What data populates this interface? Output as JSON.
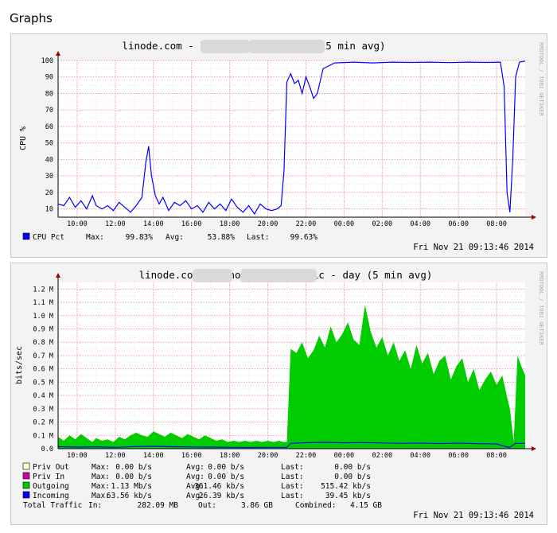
{
  "page_heading": "Graphs",
  "rrdtool_credit": "RRDTOOL / TOBI OETIKER",
  "chart_data": [
    {
      "type": "line",
      "title": "linode.com - lino( ) - CPU - day (5 min avg)",
      "ylabel": "CPU %",
      "ylim": [
        5,
        100
      ],
      "y_ticks": [
        "10",
        "20",
        "30",
        "40",
        "50",
        "60",
        "70",
        "80",
        "90",
        "100"
      ],
      "x_ticks": [
        "10:00",
        "12:00",
        "14:00",
        "16:00",
        "18:00",
        "20:00",
        "22:00",
        "00:00",
        "02:00",
        "04:00",
        "06:00",
        "08:00"
      ],
      "xlim_hours": [
        9.0,
        33.5
      ],
      "grid": true,
      "series": [
        {
          "name": "CPU Pct",
          "color": "#0000ff",
          "hours": [
            9.0,
            9.3,
            9.6,
            9.9,
            10.2,
            10.5,
            10.8,
            11.0,
            11.3,
            11.6,
            11.9,
            12.2,
            12.5,
            12.8,
            13.1,
            13.4,
            13.6,
            13.75,
            13.9,
            14.1,
            14.3,
            14.5,
            14.8,
            15.1,
            15.4,
            15.7,
            16.0,
            16.3,
            16.6,
            16.9,
            17.2,
            17.5,
            17.8,
            18.1,
            18.4,
            18.7,
            19.0,
            19.3,
            19.6,
            19.9,
            20.2,
            20.5,
            20.7,
            20.85,
            21.0,
            21.2,
            21.4,
            21.6,
            21.8,
            22.0,
            22.2,
            22.4,
            22.6,
            22.9,
            23.5,
            24.5,
            25.5,
            26.5,
            27.5,
            28.5,
            29.5,
            30.5,
            31.5,
            32.2,
            32.4,
            32.55,
            32.7,
            32.85,
            33.0,
            33.2,
            33.5
          ],
          "values": [
            13,
            12,
            17,
            11,
            15,
            10,
            18,
            12,
            10,
            12,
            9,
            14,
            11,
            8,
            12,
            17,
            38,
            48,
            30,
            18,
            13,
            17,
            9,
            14,
            12,
            15,
            10,
            12,
            8,
            14,
            10,
            13,
            9,
            16,
            11,
            8,
            12,
            7,
            13,
            10,
            9,
            10,
            12,
            33,
            87,
            92,
            86,
            88,
            80,
            90,
            84,
            77,
            80,
            95,
            98.5,
            99,
            98.5,
            99,
            98.8,
            99,
            98.7,
            99,
            98.8,
            99,
            84,
            20,
            8,
            40,
            90,
            99,
            99.6
          ]
        }
      ],
      "legend": [
        {
          "name": "CPU Pct",
          "color": "#0000ff",
          "max": "99.83%",
          "avg": "53.88%",
          "last": "99.63%"
        }
      ],
      "stat_labels": {
        "max": "Max:",
        "avg": "Avg:",
        "last": "Last:"
      },
      "timestamp": "Fri Nov 21 09:13:46 2014"
    },
    {
      "type": "area",
      "title": "linode.com - linod( ) - traffic - day (5 min avg)",
      "ylabel": "bits/sec",
      "ylim": [
        0,
        1.25
      ],
      "y_ticks": [
        "0.0",
        "0.1 M",
        "0.2 M",
        "0.3 M",
        "0.4 M",
        "0.5 M",
        "0.6 M",
        "0.7 M",
        "0.8 M",
        "0.9 M",
        "1.0 M",
        "1.1 M",
        "1.2 M"
      ],
      "x_ticks": [
        "10:00",
        "12:00",
        "14:00",
        "16:00",
        "18:00",
        "20:00",
        "22:00",
        "00:00",
        "02:00",
        "04:00",
        "06:00",
        "08:00"
      ],
      "xlim_hours": [
        9.0,
        33.5
      ],
      "grid": true,
      "series": [
        {
          "name": "Outgoing",
          "color": "#00cc00",
          "unit": "Mb/s",
          "hours": [
            9.0,
            9.3,
            9.6,
            9.9,
            10.2,
            10.5,
            10.8,
            11.0,
            11.3,
            11.6,
            11.9,
            12.2,
            12.5,
            12.8,
            13.1,
            13.4,
            13.7,
            14.0,
            14.3,
            14.6,
            14.9,
            15.2,
            15.5,
            15.8,
            16.1,
            16.4,
            16.7,
            17.0,
            17.3,
            17.6,
            17.9,
            18.2,
            18.5,
            18.8,
            19.1,
            19.4,
            19.7,
            20.0,
            20.3,
            20.6,
            20.8,
            21.0,
            21.2,
            21.5,
            21.8,
            22.1,
            22.4,
            22.7,
            23.0,
            23.3,
            23.6,
            23.9,
            24.2,
            24.5,
            24.8,
            25.1,
            25.4,
            25.7,
            26.0,
            26.3,
            26.6,
            26.9,
            27.2,
            27.5,
            27.8,
            28.1,
            28.4,
            28.7,
            29.0,
            29.3,
            29.6,
            29.9,
            30.2,
            30.5,
            30.8,
            31.1,
            31.4,
            31.7,
            32.0,
            32.3,
            32.5,
            32.7,
            32.9,
            33.1,
            33.3,
            33.5
          ],
          "values": [
            0.09,
            0.06,
            0.1,
            0.07,
            0.11,
            0.08,
            0.05,
            0.08,
            0.06,
            0.07,
            0.05,
            0.09,
            0.07,
            0.1,
            0.12,
            0.1,
            0.09,
            0.13,
            0.11,
            0.09,
            0.12,
            0.1,
            0.08,
            0.11,
            0.09,
            0.07,
            0.1,
            0.08,
            0.06,
            0.07,
            0.05,
            0.06,
            0.05,
            0.06,
            0.05,
            0.06,
            0.05,
            0.06,
            0.05,
            0.06,
            0.05,
            0.05,
            0.75,
            0.72,
            0.8,
            0.68,
            0.74,
            0.85,
            0.76,
            0.92,
            0.8,
            0.86,
            0.95,
            0.82,
            0.78,
            1.08,
            0.88,
            0.76,
            0.84,
            0.7,
            0.8,
            0.66,
            0.74,
            0.6,
            0.78,
            0.64,
            0.72,
            0.56,
            0.66,
            0.7,
            0.52,
            0.62,
            0.68,
            0.5,
            0.6,
            0.44,
            0.52,
            0.58,
            0.48,
            0.55,
            0.42,
            0.3,
            0.05,
            0.7,
            0.62,
            0.55
          ]
        },
        {
          "name": "Incoming",
          "color": "#0000ff",
          "unit": "kb/s",
          "hours": [
            9.0,
            10.0,
            11.0,
            12.0,
            13.0,
            14.0,
            15.0,
            16.0,
            17.0,
            18.0,
            19.0,
            20.0,
            21.0,
            21.2,
            22.0,
            23.0,
            24.0,
            25.0,
            26.0,
            27.0,
            28.0,
            29.0,
            30.0,
            31.0,
            32.0,
            32.5,
            32.7,
            33.0,
            33.5
          ],
          "values": [
            0.015,
            0.012,
            0.014,
            0.01,
            0.016,
            0.018,
            0.015,
            0.013,
            0.012,
            0.01,
            0.009,
            0.01,
            0.01,
            0.04,
            0.045,
            0.048,
            0.044,
            0.046,
            0.043,
            0.04,
            0.042,
            0.039,
            0.041,
            0.038,
            0.036,
            0.015,
            0.01,
            0.04,
            0.04
          ]
        }
      ],
      "legend": [
        {
          "name": "Priv Out",
          "color": "#ffffcc",
          "max": "0.00 b/s",
          "avg": "0.00 b/s",
          "last": "0.00 b/s"
        },
        {
          "name": "Priv In",
          "color": "#cc00aa",
          "max": "0.00 b/s",
          "avg": "0.00 b/s",
          "last": "0.00 b/s"
        },
        {
          "name": "Outgoing",
          "color": "#00cc00",
          "max": "1.13 Mb/s",
          "avg": "361.46 kb/s",
          "last": "515.42 kb/s"
        },
        {
          "name": "Incoming",
          "color": "#0000ff",
          "max": "63.56 kb/s",
          "avg": "26.39 kb/s",
          "last": "39.45 kb/s"
        }
      ],
      "stat_labels": {
        "max": "Max:",
        "avg": "Avg:",
        "last": "Last:"
      },
      "total_traffic": {
        "label": "Total Traffic",
        "in_label": "In:",
        "in_value": "282.09 MB",
        "out_label": "Out:",
        "out_value": "3.86 GB",
        "combined_label": "Combined:",
        "combined_value": "4.15 GB"
      },
      "timestamp": "Fri Nov 21 09:13:46 2014"
    }
  ]
}
